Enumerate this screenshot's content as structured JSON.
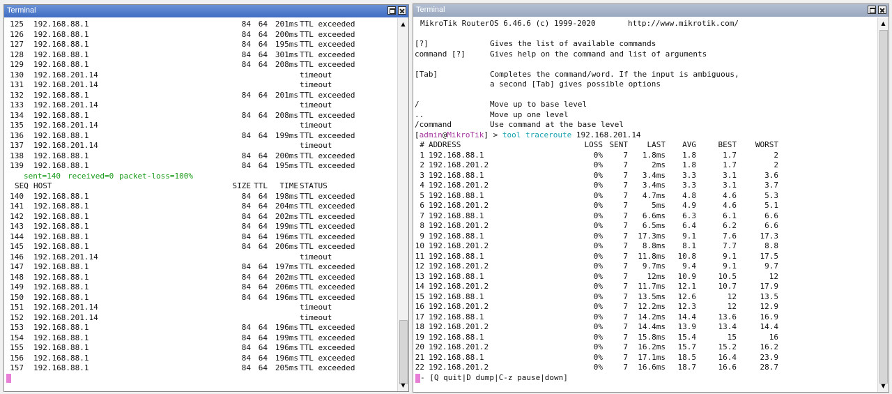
{
  "left": {
    "title": "Terminal",
    "rows": [
      [
        "125",
        "192.168.88.1",
        "84",
        "64",
        "201ms",
        "TTL exceeded"
      ],
      [
        "126",
        "192.168.88.1",
        "84",
        "64",
        "200ms",
        "TTL exceeded"
      ],
      [
        "127",
        "192.168.88.1",
        "84",
        "64",
        "195ms",
        "TTL exceeded"
      ],
      [
        "128",
        "192.168.88.1",
        "84",
        "64",
        "301ms",
        "TTL exceeded"
      ],
      [
        "129",
        "192.168.88.1",
        "84",
        "64",
        "208ms",
        "TTL exceeded"
      ],
      [
        "130",
        "192.168.201.14",
        "",
        "",
        "",
        "timeout"
      ],
      [
        "131",
        "192.168.201.14",
        "",
        "",
        "",
        "timeout"
      ],
      [
        "132",
        "192.168.88.1",
        "84",
        "64",
        "201ms",
        "TTL exceeded"
      ],
      [
        "133",
        "192.168.201.14",
        "",
        "",
        "",
        "timeout"
      ],
      [
        "134",
        "192.168.88.1",
        "84",
        "64",
        "208ms",
        "TTL exceeded"
      ],
      [
        "135",
        "192.168.201.14",
        "",
        "",
        "",
        "timeout"
      ],
      [
        "136",
        "192.168.88.1",
        "84",
        "64",
        "199ms",
        "TTL exceeded"
      ],
      [
        "137",
        "192.168.201.14",
        "",
        "",
        "",
        "timeout"
      ],
      [
        "138",
        "192.168.88.1",
        "84",
        "64",
        "200ms",
        "TTL exceeded"
      ],
      [
        "139",
        "192.168.88.1",
        "84",
        "64",
        "195ms",
        "TTL exceeded"
      ]
    ],
    "summary": {
      "sent": "sent=140",
      "received": "received=0",
      "loss": "packet-loss=100%"
    },
    "headers": [
      "SEQ",
      "HOST",
      "SIZE",
      "TTL",
      "TIME",
      "STATUS"
    ],
    "rows2": [
      [
        "140",
        "192.168.88.1",
        "84",
        "64",
        "198ms",
        "TTL exceeded"
      ],
      [
        "141",
        "192.168.88.1",
        "84",
        "64",
        "204ms",
        "TTL exceeded"
      ],
      [
        "142",
        "192.168.88.1",
        "84",
        "64",
        "202ms",
        "TTL exceeded"
      ],
      [
        "143",
        "192.168.88.1",
        "84",
        "64",
        "199ms",
        "TTL exceeded"
      ],
      [
        "144",
        "192.168.88.1",
        "84",
        "64",
        "196ms",
        "TTL exceeded"
      ],
      [
        "145",
        "192.168.88.1",
        "84",
        "64",
        "206ms",
        "TTL exceeded"
      ],
      [
        "146",
        "192.168.201.14",
        "",
        "",
        "",
        "timeout"
      ],
      [
        "147",
        "192.168.88.1",
        "84",
        "64",
        "197ms",
        "TTL exceeded"
      ],
      [
        "148",
        "192.168.88.1",
        "84",
        "64",
        "202ms",
        "TTL exceeded"
      ],
      [
        "149",
        "192.168.88.1",
        "84",
        "64",
        "206ms",
        "TTL exceeded"
      ],
      [
        "150",
        "192.168.88.1",
        "84",
        "64",
        "196ms",
        "TTL exceeded"
      ],
      [
        "151",
        "192.168.201.14",
        "",
        "",
        "",
        "timeout"
      ],
      [
        "152",
        "192.168.201.14",
        "",
        "",
        "",
        "timeout"
      ],
      [
        "153",
        "192.168.88.1",
        "84",
        "64",
        "196ms",
        "TTL exceeded"
      ],
      [
        "154",
        "192.168.88.1",
        "84",
        "64",
        "199ms",
        "TTL exceeded"
      ],
      [
        "155",
        "192.168.88.1",
        "84",
        "64",
        "196ms",
        "TTL exceeded"
      ],
      [
        "156",
        "192.168.88.1",
        "84",
        "64",
        "196ms",
        "TTL exceeded"
      ],
      [
        "157",
        "192.168.88.1",
        "84",
        "64",
        "205ms",
        "TTL exceeded"
      ]
    ]
  },
  "right": {
    "title": "Terminal",
    "banner": "MikroTik RouterOS 6.46.6 (c) 1999-2020       http://www.mikrotik.com/",
    "help": [
      [
        "[?]",
        "Gives the list of available commands"
      ],
      [
        "command [?]",
        "Gives help on the command and list of arguments"
      ],
      [
        "",
        ""
      ],
      [
        "[Tab]",
        "Completes the command/word. If the input is ambiguous,"
      ],
      [
        "",
        "a second [Tab] gives possible options"
      ],
      [
        "",
        ""
      ],
      [
        "/",
        "Move up to base level"
      ],
      [
        "..",
        "Move up one level"
      ],
      [
        "/command",
        "Use command at the base level"
      ]
    ],
    "prompt": {
      "open": "[",
      "user": "admin",
      "at": "@",
      "host": "MikroTik",
      "close": "] > ",
      "cmd1": "tool",
      "cmd2": "traceroute",
      "arg": "192.168.201.14"
    },
    "headers": [
      "#",
      "ADDRESS",
      "LOSS",
      "SENT",
      "LAST",
      "AVG",
      "BEST",
      "WORST"
    ],
    "rows": [
      [
        "1",
        "192.168.88.1",
        "0%",
        "7",
        "1.8ms",
        "1.8",
        "1.7",
        "2"
      ],
      [
        "2",
        "192.168.201.2",
        "0%",
        "7",
        "2ms",
        "1.8",
        "1.7",
        "2"
      ],
      [
        "3",
        "192.168.88.1",
        "0%",
        "7",
        "3.4ms",
        "3.3",
        "3.1",
        "3.6"
      ],
      [
        "4",
        "192.168.201.2",
        "0%",
        "7",
        "3.4ms",
        "3.3",
        "3.1",
        "3.7"
      ],
      [
        "5",
        "192.168.88.1",
        "0%",
        "7",
        "4.7ms",
        "4.8",
        "4.6",
        "5.3"
      ],
      [
        "6",
        "192.168.201.2",
        "0%",
        "7",
        "5ms",
        "4.9",
        "4.6",
        "5.1"
      ],
      [
        "7",
        "192.168.88.1",
        "0%",
        "7",
        "6.6ms",
        "6.3",
        "6.1",
        "6.6"
      ],
      [
        "8",
        "192.168.201.2",
        "0%",
        "7",
        "6.5ms",
        "6.4",
        "6.2",
        "6.6"
      ],
      [
        "9",
        "192.168.88.1",
        "0%",
        "7",
        "17.3ms",
        "9.1",
        "7.6",
        "17.3"
      ],
      [
        "10",
        "192.168.201.2",
        "0%",
        "7",
        "8.8ms",
        "8.1",
        "7.7",
        "8.8"
      ],
      [
        "11",
        "192.168.88.1",
        "0%",
        "7",
        "11.8ms",
        "10.8",
        "9.1",
        "17.5"
      ],
      [
        "12",
        "192.168.201.2",
        "0%",
        "7",
        "9.7ms",
        "9.4",
        "9.1",
        "9.7"
      ],
      [
        "13",
        "192.168.88.1",
        "0%",
        "7",
        "12ms",
        "10.9",
        "10.5",
        "12"
      ],
      [
        "14",
        "192.168.201.2",
        "0%",
        "7",
        "11.7ms",
        "12.1",
        "10.7",
        "17.9"
      ],
      [
        "15",
        "192.168.88.1",
        "0%",
        "7",
        "13.5ms",
        "12.6",
        "12",
        "13.5"
      ],
      [
        "16",
        "192.168.201.2",
        "0%",
        "7",
        "12.2ms",
        "12.3",
        "12",
        "12.9"
      ],
      [
        "17",
        "192.168.88.1",
        "0%",
        "7",
        "14.2ms",
        "14.4",
        "13.6",
        "16.9"
      ],
      [
        "18",
        "192.168.201.2",
        "0%",
        "7",
        "14.4ms",
        "13.9",
        "13.4",
        "14.4"
      ],
      [
        "19",
        "192.168.88.1",
        "0%",
        "7",
        "15.8ms",
        "15.4",
        "15",
        "16"
      ],
      [
        "20",
        "192.168.201.2",
        "0%",
        "7",
        "16.2ms",
        "15.7",
        "15.2",
        "16.2"
      ],
      [
        "21",
        "192.168.88.1",
        "0%",
        "7",
        "17.1ms",
        "18.5",
        "16.4",
        "23.9"
      ],
      [
        "22",
        "192.168.201.2",
        "0%",
        "7",
        "16.6ms",
        "18.7",
        "16.6",
        "28.7"
      ]
    ],
    "footer": "- [Q quit|D dump|C-z pause|down]"
  }
}
